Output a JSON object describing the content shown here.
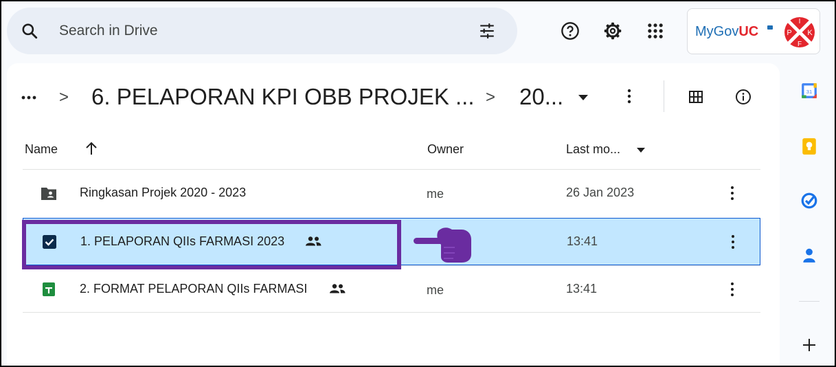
{
  "search": {
    "placeholder": "Search in Drive"
  },
  "badge": {
    "brand_prefix": "MyGov",
    "brand_suffix": "UC",
    "logo_letters": [
      "P",
      "I",
      "K",
      "F"
    ]
  },
  "breadcrumb": {
    "more": "…",
    "sep": ">",
    "folder": "6. PELAPORAN KPI OBB PROJEK ...",
    "current": "20..."
  },
  "columns": {
    "name": "Name",
    "owner": "Owner",
    "modified": "Last mo..."
  },
  "rows": [
    {
      "name": "Ringkasan Projek 2020 - 2023",
      "owner": "me",
      "modified": "26 Jan 2023",
      "icon": "shared-folder-icon",
      "shared": false,
      "selected": false
    },
    {
      "name": "1. PELAPORAN QIIs FARMASI 2023",
      "owner": "",
      "modified": "13:41",
      "icon": "checkbox-checked-icon",
      "shared": true,
      "selected": true
    },
    {
      "name": "2. FORMAT PELAPORAN QIIs FARMASI",
      "owner": "me",
      "modified": "13:41",
      "icon": "google-sheets-icon",
      "shared": true,
      "selected": false
    }
  ],
  "colors": {
    "selected_row": "#c2e7ff",
    "highlight_border": "#6a2ca0",
    "sheets_green": "#1e8e3e",
    "brand_blue": "#1f6fb5",
    "brand_red": "#e3262d"
  },
  "rail": [
    "google-calendar-icon",
    "google-keep-icon",
    "google-tasks-icon",
    "google-contacts-icon"
  ]
}
